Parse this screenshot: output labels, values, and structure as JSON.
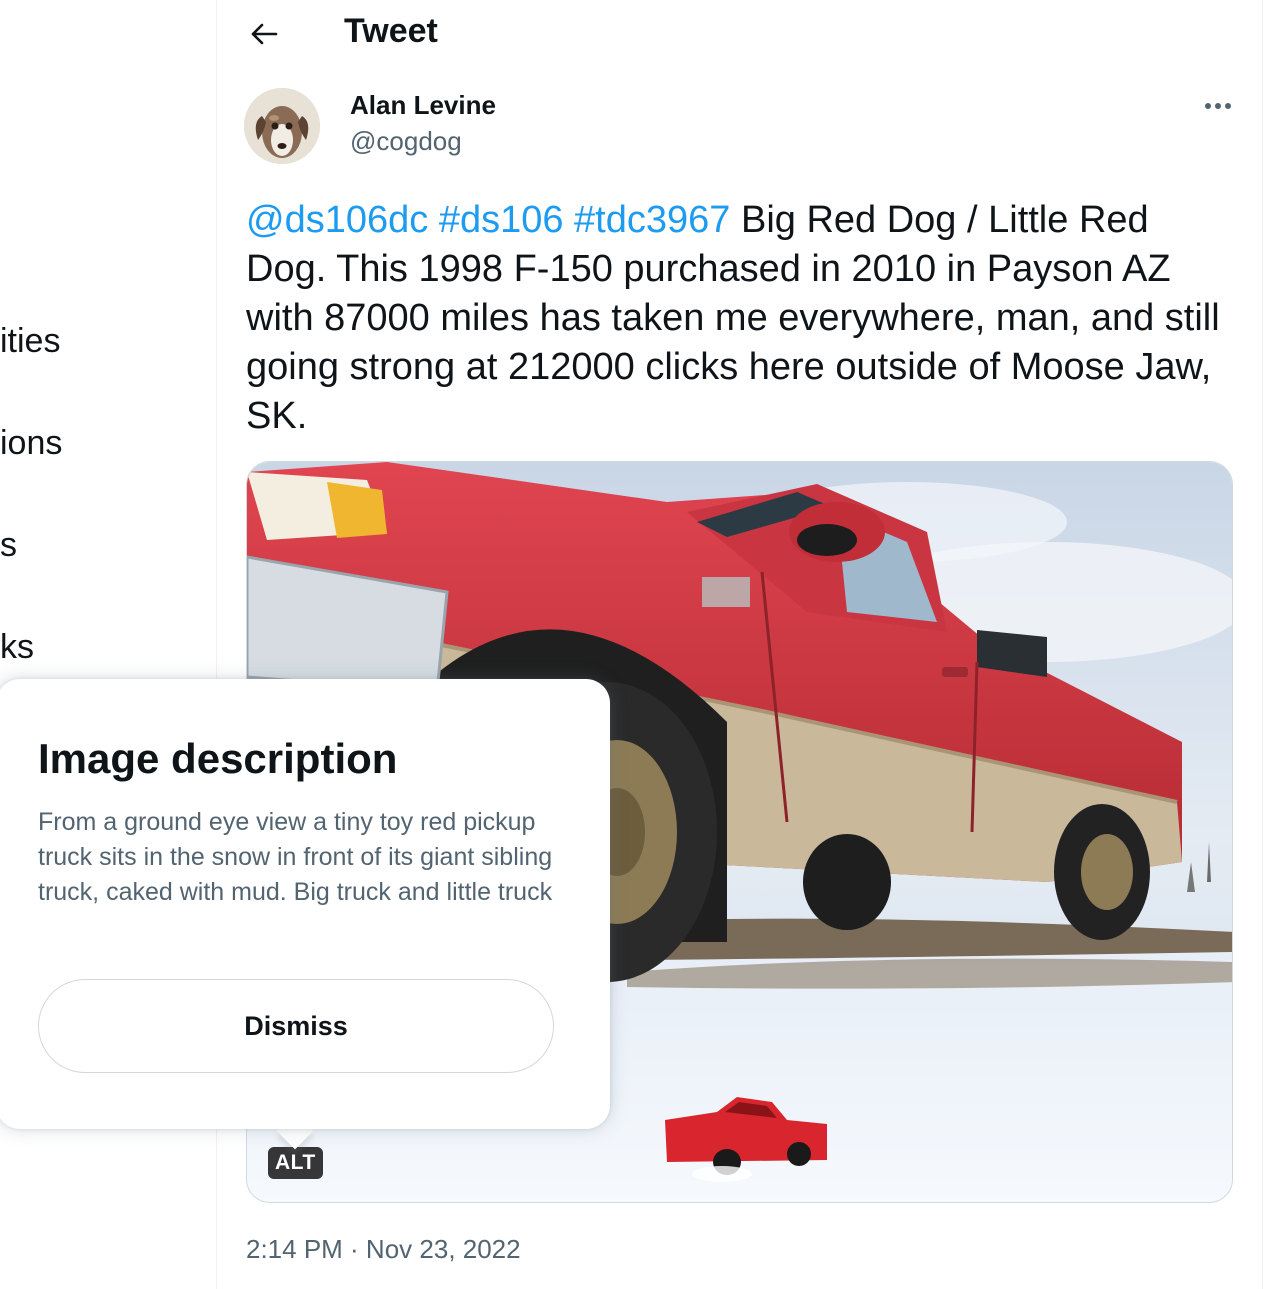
{
  "sidebar": {
    "items": [
      {
        "label": "ities"
      },
      {
        "label": "ions"
      },
      {
        "label": "s"
      },
      {
        "label": "ks"
      }
    ]
  },
  "header": {
    "title": "Tweet",
    "back_icon": "arrow-left-icon"
  },
  "tweet": {
    "author_name": "Alan Levine",
    "author_handle": "@cogdog",
    "more_icon": "more-horizontal-icon",
    "mention": "@ds106dc",
    "hashtag_1": "#ds106",
    "hashtag_2": "#tdc3967",
    "body": "Big Red Dog / Little Red Dog. This 1998 F-150 purchased in 2010 in Payson AZ with 87000 miles has taken me everywhere, man, and still going strong at 212000 clicks here outside of Moose Jaw, SK.",
    "alt_badge": "ALT",
    "timestamp": "2:14 PM · Nov 23, 2022"
  },
  "popover": {
    "title": "Image description",
    "body": "From a ground eye view a tiny toy red pickup truck sits in the snow in front of its giant sibling truck, caked with mud. Big truck and little truck",
    "dismiss_label": "Dismiss"
  },
  "colors": {
    "link": "#1d9bf0",
    "text_primary": "#0f1419",
    "text_secondary": "#536471",
    "truck_red": "#d8343c",
    "snow": "#eef3fa"
  }
}
